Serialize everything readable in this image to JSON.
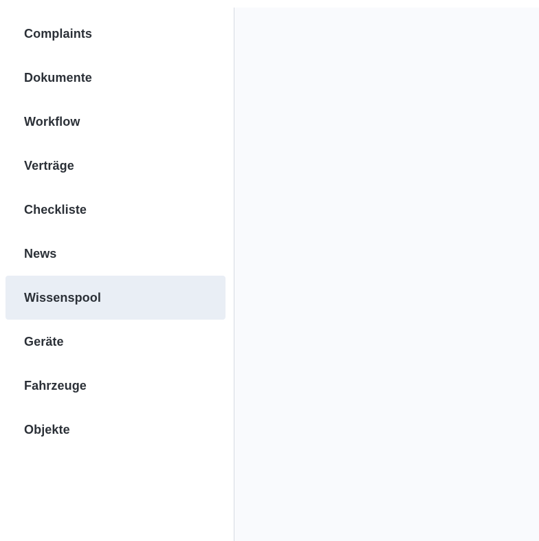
{
  "sidebar": {
    "items": [
      {
        "label": "Complaints",
        "active": false
      },
      {
        "label": "Dokumente",
        "active": false
      },
      {
        "label": "Workflow",
        "active": false
      },
      {
        "label": "Verträge",
        "active": false
      },
      {
        "label": "Checkliste",
        "active": false
      },
      {
        "label": "News",
        "active": false
      },
      {
        "label": "Wissenspool",
        "active": true
      },
      {
        "label": "Geräte",
        "active": false
      },
      {
        "label": "Fahrzeuge",
        "active": false
      },
      {
        "label": "Objekte",
        "active": false
      }
    ]
  },
  "colors": {
    "active_background": "#e9eef5",
    "text": "#2b3037",
    "divider": "#d5dae2",
    "content_background": "#f9fafd"
  }
}
